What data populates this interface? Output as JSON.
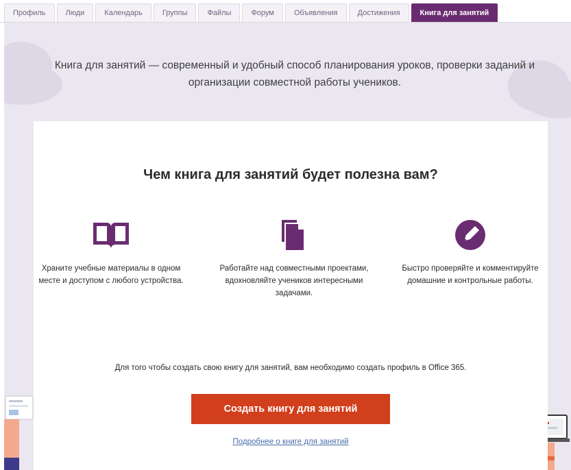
{
  "tabs": [
    {
      "label": "Профиль",
      "active": false
    },
    {
      "label": "Люди",
      "active": false
    },
    {
      "label": "Календарь",
      "active": false
    },
    {
      "label": "Группы",
      "active": false
    },
    {
      "label": "Файлы",
      "active": false
    },
    {
      "label": "Форум",
      "active": false
    },
    {
      "label": "Объявления",
      "active": false
    },
    {
      "label": "Достижения",
      "active": false
    },
    {
      "label": "Книга для занятий",
      "active": true
    }
  ],
  "hero": {
    "intro": "Книга для занятий — современный и удобный способ планирования уроков, проверки заданий и организации совместной работы учеников."
  },
  "card": {
    "title": "Чем книга для занятий будет полезна вам?",
    "features": [
      {
        "icon": "book-icon",
        "text": "Храните учебные материалы в одном месте и доступом с любого устройства."
      },
      {
        "icon": "documents-icon",
        "text": "Работайте над совместными проектами, вдохновляйте учеников интересными задачами."
      },
      {
        "icon": "pen-icon",
        "text": "Быстро проверяйте и комментируйте домашние и контрольные работы."
      }
    ],
    "notice": "Для того чтобы создать свою книгу для занятий, вам необходимо создать профиль в Office 365.",
    "cta_label": "Создать книгу для занятий",
    "more_link": "Подробнее о книге для занятий"
  },
  "colors": {
    "accent": "#6a2c70",
    "cta": "#d13f1c",
    "hero_bg": "#ebe7f0",
    "link": "#4a6ea9"
  }
}
